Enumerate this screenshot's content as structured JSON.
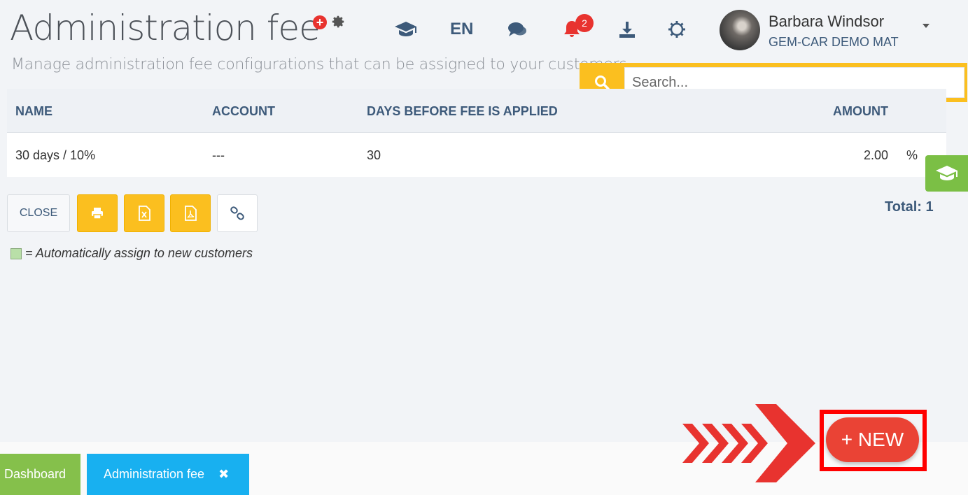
{
  "header": {
    "title": "Administration fee",
    "subtitle": "Manage administration fee configurations that can be assigned to your customers",
    "icons": [
      "plus-circle-icon",
      "gear-icon"
    ]
  },
  "topnav": {
    "language": "EN",
    "notification_count": "2",
    "icons": [
      "graduation-cap-icon",
      "chat-icon",
      "bell-icon",
      "download-icon",
      "settings-icon"
    ],
    "user": {
      "name": "Barbara Windsor",
      "company": "GEM-CAR DEMO MAT"
    }
  },
  "search": {
    "placeholder": "Search..."
  },
  "table": {
    "columns": [
      "NAME",
      "ACCOUNT",
      "DAYS BEFORE FEE IS APPLIED",
      "AMOUNT"
    ],
    "rows": [
      {
        "name": "30 days / 10%",
        "account": "---",
        "days": "30",
        "amount": "2.00",
        "unit": "%"
      }
    ]
  },
  "actions": {
    "close_label": "CLOSE",
    "icons": [
      "print-icon",
      "excel-icon",
      "pdf-icon",
      "link-icon"
    ]
  },
  "total": "Total: 1",
  "legend": "= Automatically assign to new customers",
  "tabs": [
    {
      "label": "Dashboard"
    },
    {
      "label": "Administration fee"
    }
  ],
  "new_button": "+ NEW",
  "colors": {
    "accent_yellow": "#fbbf1f",
    "header_blue": "#3d5a7a",
    "new_red": "#ea4335",
    "tab_green": "#85c04b",
    "tab_blue": "#18b0f0"
  }
}
